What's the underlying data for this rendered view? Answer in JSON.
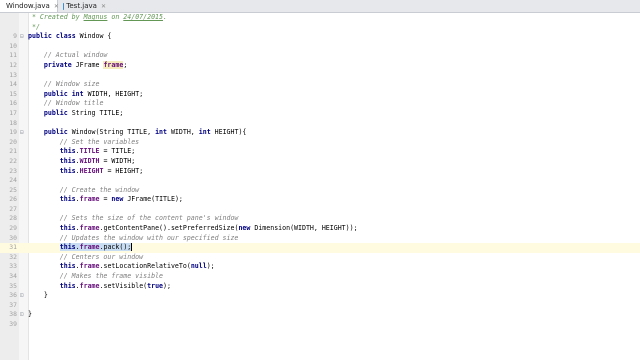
{
  "tabs": [
    {
      "label": "Window.java",
      "active": true,
      "icon": "java-class-icon",
      "color": "#3d8fd1"
    },
    {
      "label": "Test.java",
      "active": false,
      "icon": "java-class-icon",
      "color": "#3d8fd1"
    }
  ],
  "editor": {
    "language": "java",
    "current_line": 34,
    "lines": [
      {
        "n": "",
        "text": " * Created by Magnus on 24/07/2015."
      },
      {
        "n": "",
        "text": " */"
      },
      {
        "n": "9",
        "text": "public class Window {"
      },
      {
        "n": "10",
        "text": ""
      },
      {
        "n": "11",
        "text": "    // Actual window"
      },
      {
        "n": "12",
        "text": "    private JFrame frame;"
      },
      {
        "n": "13",
        "text": ""
      },
      {
        "n": "14",
        "text": "    // Window size"
      },
      {
        "n": "15",
        "text": "    public int WIDTH, HEIGHT;"
      },
      {
        "n": "16",
        "text": "    // Window title"
      },
      {
        "n": "17",
        "text": "    public String TITLE;"
      },
      {
        "n": "18",
        "text": ""
      },
      {
        "n": "19",
        "text": "    public Window(String TITLE, int WIDTH, int HEIGHT){"
      },
      {
        "n": "20",
        "text": "        // Set the variables"
      },
      {
        "n": "21",
        "text": "        this.TITLE = TITLE;"
      },
      {
        "n": "22",
        "text": "        this.WIDTH = WIDTH;"
      },
      {
        "n": "23",
        "text": "        this.HEIGHT = HEIGHT;"
      },
      {
        "n": "24",
        "text": ""
      },
      {
        "n": "25",
        "text": "        // Create the window"
      },
      {
        "n": "26",
        "text": "        this.frame = new JFrame(TITLE);"
      },
      {
        "n": "27",
        "text": ""
      },
      {
        "n": "28",
        "text": "        // Sets the size of the content pane's window"
      },
      {
        "n": "29",
        "text": "        this.frame.getContentPane().setPreferredSize(new Dimension(WIDTH, HEIGHT));"
      },
      {
        "n": "30",
        "text": "        // Updates the window with our specified size"
      },
      {
        "n": "31",
        "text": "        this.frame.pack();"
      },
      {
        "n": "32",
        "text": "        // Centers our window"
      },
      {
        "n": "33",
        "text": "        this.frame.setLocationRelativeTo(null);"
      },
      {
        "n": "34",
        "text": "        // Makes the frame visible"
      },
      {
        "n": "35",
        "text": "        this.frame.setVisible(true);"
      },
      {
        "n": "36",
        "text": "    }"
      },
      {
        "n": "37",
        "text": ""
      },
      {
        "n": "38",
        "text": "}"
      },
      {
        "n": "39",
        "text": ""
      }
    ]
  }
}
